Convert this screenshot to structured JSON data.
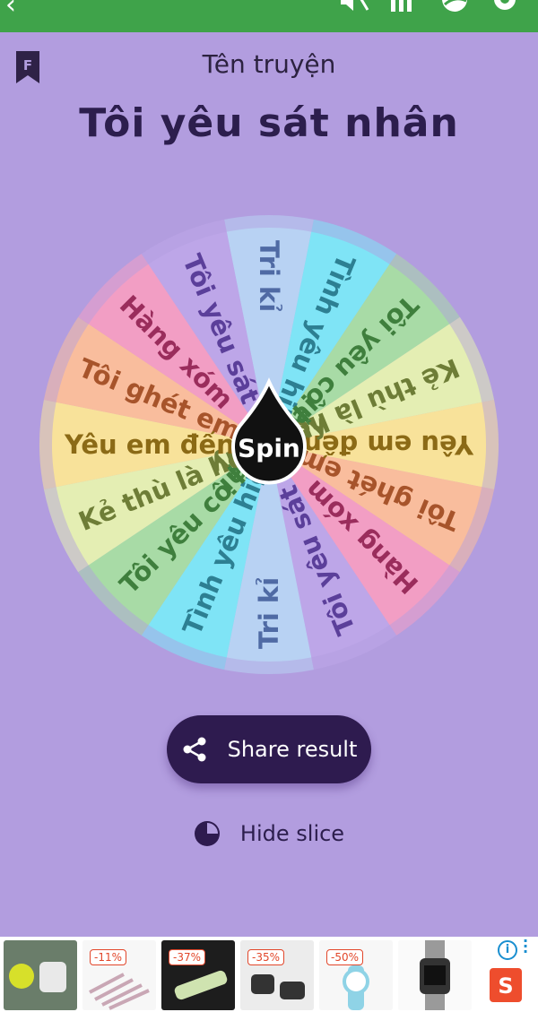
{
  "colors": {
    "background": "#b29ddf",
    "topbar": "#3fa34a",
    "title": "#2c1e4d",
    "button": "#2e1b4f"
  },
  "topbar": {
    "icons": [
      "back-icon",
      "mute-icon",
      "list-icon",
      "theme-icon",
      "settings-icon"
    ]
  },
  "header": {
    "label": "Tên truyện",
    "title": "Tôi yêu sát nhân"
  },
  "wheel": {
    "center_label": "Spin",
    "slices": [
      {
        "label": "Tri kỉ",
        "color": "#b8d2f3",
        "text_color": "#4f6aa4"
      },
      {
        "label": "Tình yêu hiện tại",
        "color": "#7fe4f6",
        "text_color": "#2d7f92"
      },
      {
        "label": "Tôi yêu cô hiện tại",
        "color": "#a8dba6",
        "text_color": "#3f7f3d"
      },
      {
        "label": "Kẻ thù là hôm nay",
        "color": "#e4eeb3",
        "text_color": "#6e7d37"
      },
      {
        "label": "Yêu em đến chết",
        "color": "#f8e29a",
        "text_color": "#8b6a16"
      },
      {
        "label": "Tôi ghét em",
        "color": "#f9bd9d",
        "text_color": "#a7542b"
      },
      {
        "label": "Hàng xóm",
        "color": "#f29ec4",
        "text_color": "#9a2d5c"
      },
      {
        "label": "Tôi yêu sát nhân",
        "color": "#bda6e8",
        "text_color": "#5b3f9a"
      },
      {
        "label": "Tri kỉ",
        "color": "#b8d2f3",
        "text_color": "#4f6aa4"
      },
      {
        "label": "Tình yêu hiện tại",
        "color": "#7fe4f6",
        "text_color": "#2d7f92"
      },
      {
        "label": "Tôi yêu cô hiện tại",
        "color": "#a8dba6",
        "text_color": "#3f7f3d"
      },
      {
        "label": "Kẻ thù là hôm nay",
        "color": "#e4eeb3",
        "text_color": "#6e7d37"
      },
      {
        "label": "Yêu em đến chết",
        "color": "#f8e29a",
        "text_color": "#8b6a16"
      },
      {
        "label": "Tôi ghét em",
        "color": "#f9bd9d",
        "text_color": "#a7542b"
      },
      {
        "label": "Hàng xóm",
        "color": "#f29ec4",
        "text_color": "#9a2d5c"
      },
      {
        "label": "Tôi yêu sát nhân",
        "color": "#bda6e8",
        "text_color": "#5b3f9a"
      }
    ]
  },
  "actions": {
    "share_label": "Share result",
    "hide_label": "Hide slice"
  },
  "ads": {
    "items": [
      {
        "badge": "",
        "icon": "watch-ball-product-icon"
      },
      {
        "badge": "-11%",
        "icon": "pens-product-icon"
      },
      {
        "badge": "-37%",
        "icon": "nail-tool-product-icon"
      },
      {
        "badge": "-35%",
        "icon": "bags-product-icon"
      },
      {
        "badge": "-50%",
        "icon": "kids-watch-product-icon"
      },
      {
        "badge": "",
        "icon": "digital-watch-product-icon"
      }
    ],
    "info_label": "i",
    "store_label": "S"
  }
}
